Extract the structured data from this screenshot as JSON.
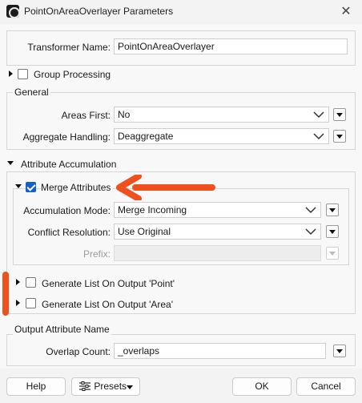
{
  "window": {
    "title": "PointOnAreaOverlayer Parameters",
    "close_glyph": "✕"
  },
  "transformer_name": {
    "label": "Transformer Name:",
    "value": "PointOnAreaOverlayer"
  },
  "group_processing": {
    "label": "Group Processing",
    "checked": false
  },
  "general": {
    "title": "General",
    "areas_first": {
      "label": "Areas First:",
      "value": "No"
    },
    "aggregate_handling": {
      "label": "Aggregate Handling:",
      "value": "Deaggregate"
    }
  },
  "attribute_accumulation": {
    "title": "Attribute Accumulation",
    "merge_attributes": {
      "label": "Merge Attributes",
      "checked": true
    },
    "accumulation_mode": {
      "label": "Accumulation Mode:",
      "value": "Merge Incoming"
    },
    "conflict_resolution": {
      "label": "Conflict Resolution:",
      "value": "Use Original"
    },
    "prefix": {
      "label": "Prefix:",
      "value": ""
    },
    "list_point": {
      "label": "Generate List On Output 'Point'",
      "checked": false
    },
    "list_area": {
      "label": "Generate List On Output 'Area'",
      "checked": false
    }
  },
  "output_attribute_name": {
    "title": "Output Attribute Name",
    "overlap_count": {
      "label": "Overlap Count:",
      "value": "_overlaps"
    }
  },
  "footer": {
    "help": "Help",
    "presets": "Presets",
    "ok": "OK",
    "cancel": "Cancel"
  },
  "colors": {
    "accent": "#1460c8",
    "annotation": "#f0501e"
  },
  "icons": [
    "app-icon",
    "close-icon",
    "chevron-down-icon",
    "dropdown-arrow-icon",
    "expand-triangle-icon",
    "presets-icon"
  ]
}
